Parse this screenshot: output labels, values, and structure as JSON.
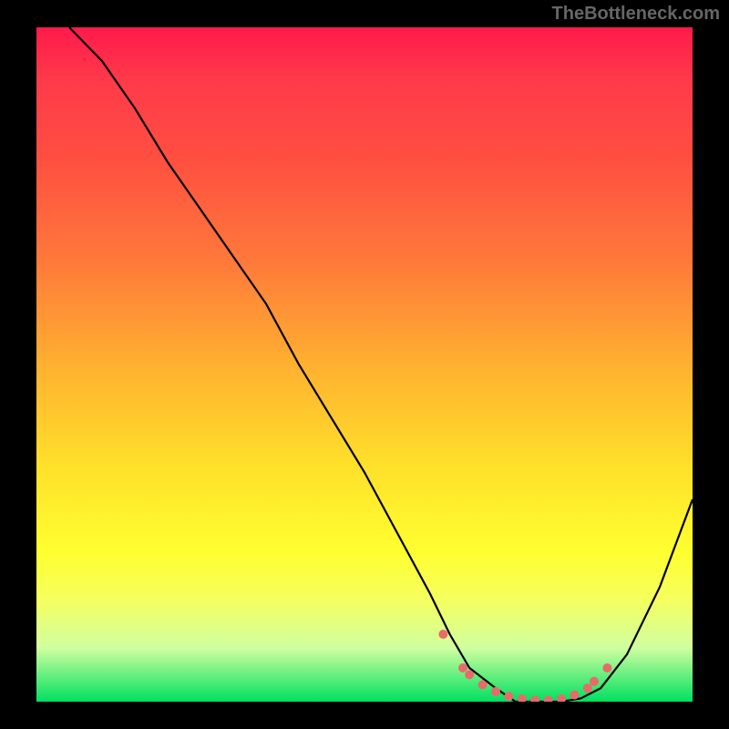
{
  "watermark": "TheBottleneck.com",
  "chart_data": {
    "type": "line",
    "title": "",
    "xlabel": "",
    "ylabel": "",
    "xlim": [
      0,
      100
    ],
    "ylim": [
      0,
      100
    ],
    "series": [
      {
        "name": "bottleneck-curve",
        "x": [
          5,
          10,
          15,
          20,
          25,
          30,
          35,
          40,
          45,
          50,
          55,
          60,
          63,
          66,
          70,
          73,
          76,
          80,
          83,
          86,
          90,
          95,
          100
        ],
        "values": [
          100,
          95,
          88,
          80,
          73,
          66,
          59,
          50,
          42,
          34,
          25,
          16,
          10,
          5,
          2,
          0,
          0,
          0,
          0.5,
          2,
          7,
          17,
          30
        ]
      }
    ],
    "markers": {
      "name": "highlight-dots",
      "x": [
        62,
        65,
        66,
        68,
        70,
        72,
        74,
        76,
        78,
        80,
        82,
        84,
        85,
        87
      ],
      "values": [
        10,
        5,
        4,
        2.5,
        1.5,
        0.8,
        0.4,
        0.2,
        0.2,
        0.4,
        1,
        2,
        3,
        5
      ],
      "color": "#e86a6a"
    }
  }
}
